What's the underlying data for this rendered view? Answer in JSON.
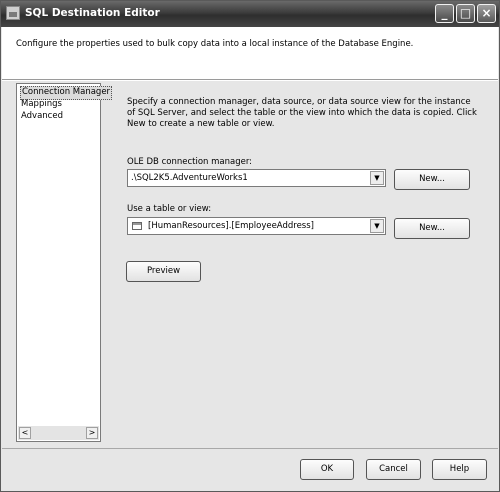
{
  "window": {
    "title": "SQL Destination Editor",
    "buttons": {
      "minimize": "_",
      "maximize": "□",
      "close": "×"
    }
  },
  "description": "Configure the properties used to bulk copy data into a local instance of the Database Engine.",
  "nav": {
    "items": [
      {
        "label": "Connection Manager",
        "selected": true
      },
      {
        "label": "Mappings",
        "selected": false
      },
      {
        "label": "Advanced",
        "selected": false
      }
    ],
    "scroll_left": "<",
    "scroll_right": ">"
  },
  "main": {
    "instructions": "Specify a connection manager, data source, or data source view for the instance of SQL Server, and select the table or the view into which the data is copied. Click New to create a new table or view.",
    "connection_label": "OLE DB connection manager:",
    "connection_value": ".\\SQL2K5.AdventureWorks1",
    "connection_new": "New...",
    "table_label": "Use a table or view:",
    "table_value": "[HumanResources].[EmployeeAddress]",
    "table_new": "New...",
    "preview": "Preview",
    "dropdown_arrow": "▼"
  },
  "footer": {
    "ok": "OK",
    "cancel": "Cancel",
    "help": "Help"
  },
  "icons": {
    "app": "app-icon",
    "table": "table-icon",
    "dropdown": "chevron-down-icon"
  },
  "colors": {
    "titlebar": "#3c3c3c",
    "dialog": "#e6e6e6",
    "selection": "#dcdcdc"
  }
}
